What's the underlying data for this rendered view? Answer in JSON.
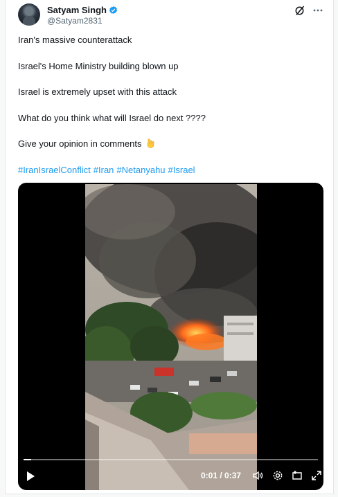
{
  "author": {
    "display_name": "Satyam Singh",
    "handle": "@Satyam2831"
  },
  "icons": {
    "verified": "verified-badge-icon",
    "grok": "grok-icon",
    "more": "more-icon",
    "emoji": "backhand-index-pointing-down"
  },
  "tweet": {
    "lines": [
      "Iran's massive counterattack",
      "Israel's Home Ministry building blown up",
      "Israel is extremely upset with this attack",
      "What do you think what will Israel do next ????",
      "Give your opinion in comments"
    ],
    "hashtags": [
      "#IranIsraelConflict",
      "#Iran",
      "#Netanyahu",
      "#Israel"
    ]
  },
  "video": {
    "time": "0:01 / 0:37",
    "progress_fraction": 0.027
  },
  "colors": {
    "accent": "#1d9bf0",
    "text": "#0f1419",
    "muted": "#536471"
  }
}
